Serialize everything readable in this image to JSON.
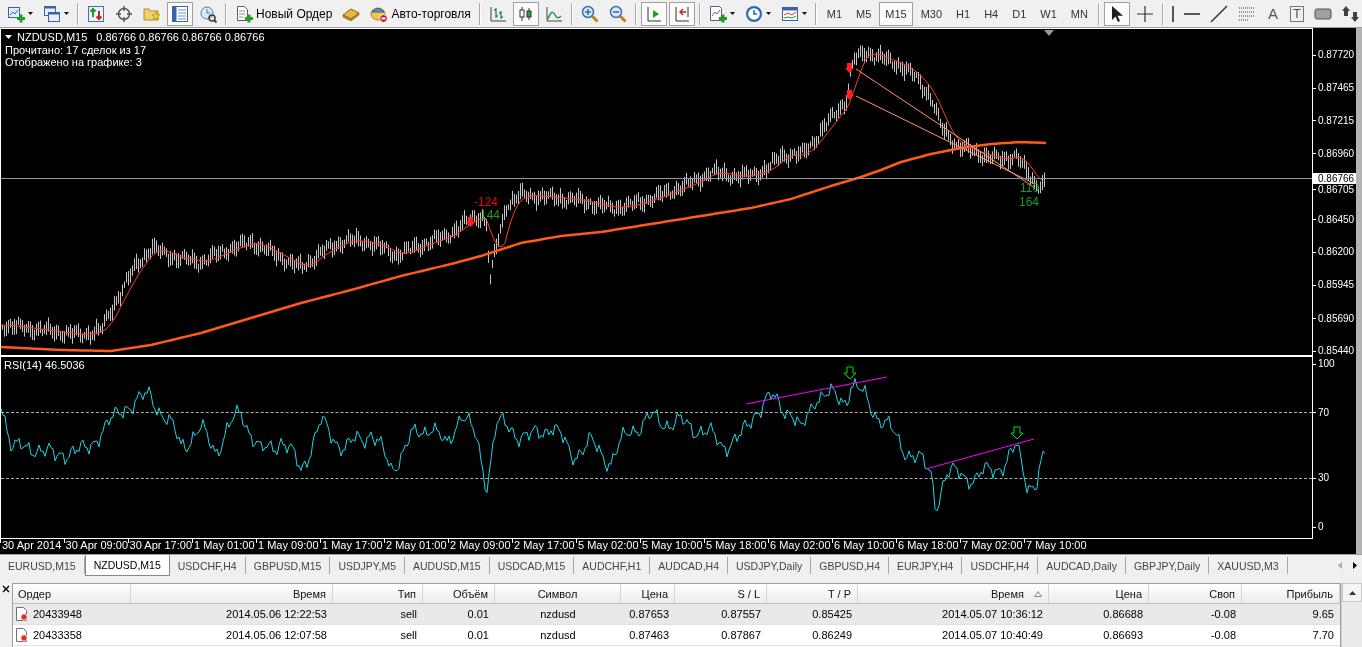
{
  "toolbar": [
    {
      "items": [
        {
          "kind": "icon",
          "dropdown": true,
          "pressed": false
        },
        {
          "kind": "icon",
          "dropdown": true,
          "pressed": false
        }
      ]
    },
    {
      "items": [
        {
          "kind": "icon",
          "pressed": false
        },
        {
          "kind": "icon",
          "pressed": false
        },
        {
          "kind": "icon",
          "pressed": false
        },
        {
          "kind": "icon",
          "pressed": true
        },
        {
          "kind": "icon",
          "pressed": false
        }
      ]
    },
    {
      "items": [
        {
          "kind": "icon_label",
          "label": "Новый Ордер",
          "pressed": false
        },
        {
          "kind": "icon",
          "pressed": false
        },
        {
          "kind": "icon_label",
          "label": "Авто-торговля",
          "pressed": false
        }
      ]
    },
    {
      "items": [
        {
          "kind": "icon",
          "pressed": false
        },
        {
          "kind": "icon",
          "pressed": true
        },
        {
          "kind": "icon",
          "pressed": false
        }
      ]
    },
    {
      "items": [
        {
          "kind": "icon",
          "pressed": false
        },
        {
          "kind": "icon",
          "pressed": false
        }
      ]
    },
    {
      "items": [
        {
          "kind": "icon",
          "pressed": true
        },
        {
          "kind": "icon",
          "pressed": true
        }
      ]
    },
    {
      "items": [
        {
          "kind": "icon",
          "dropdown": true,
          "pressed": false
        },
        {
          "kind": "icon",
          "dropdown": true,
          "pressed": false
        },
        {
          "kind": "icon",
          "dropdown": true,
          "pressed": false
        }
      ]
    },
    {
      "items": [
        {
          "kind": "text",
          "label": "M1",
          "selected": false
        },
        {
          "kind": "text",
          "label": "M5",
          "selected": false
        },
        {
          "kind": "text",
          "label": "M15",
          "selected": true
        },
        {
          "kind": "text",
          "label": "M30",
          "selected": false
        },
        {
          "kind": "text",
          "label": "H1",
          "selected": false
        },
        {
          "kind": "text",
          "label": "H4",
          "selected": false
        },
        {
          "kind": "text",
          "label": "D1",
          "selected": false
        },
        {
          "kind": "text",
          "label": "W1",
          "selected": false
        },
        {
          "kind": "text",
          "label": "MN",
          "selected": false
        }
      ]
    },
    {
      "items": [
        {
          "kind": "icon",
          "pressed": true
        },
        {
          "kind": "icon",
          "pressed": false
        }
      ]
    },
    {
      "items": [
        {
          "kind": "icon",
          "pressed": false
        },
        {
          "kind": "icon",
          "pressed": false
        },
        {
          "kind": "icon",
          "pressed": false
        },
        {
          "kind": "icon",
          "pressed": false
        },
        {
          "kind": "glyph",
          "label": "A",
          "pressed": false
        },
        {
          "kind": "boxed_glyph",
          "label": "T",
          "pressed": false
        },
        {
          "kind": "icon",
          "pressed": false
        },
        {
          "kind": "icon",
          "pressed": false
        }
      ]
    }
  ],
  "chart": {
    "symbol": "NZDUSD,M15",
    "ohlc": "0.86766 0.86766 0.86766 0.86766",
    "info_lines": [
      "Прочитано: 17 сделок из 17",
      "Отображено на графике: 3"
    ],
    "price_axis": [
      "0.87720",
      "0.87465",
      "0.87215",
      "0.86960",
      "0.86705",
      "0.86450",
      "0.86200",
      "0.85945",
      "0.85690",
      "0.85440"
    ],
    "current_price": "0.86766",
    "trade_labels": [
      {
        "text": "-124",
        "color": "#ff0000"
      },
      {
        "text": "144",
        "color": "#1e9a1e"
      },
      {
        "text": "110",
        "color": "#1e9a1e"
      },
      {
        "text": "164",
        "color": "#1e9a1e"
      }
    ],
    "indicator": {
      "label": "RSI(14) 46.5036",
      "axis": [
        {
          "label": "100",
          "level_line": false
        },
        {
          "label": "70",
          "level_line": true
        },
        {
          "label": "30",
          "level_line": true
        },
        {
          "label": "0",
          "level_line": false
        }
      ]
    },
    "time_axis": [
      "30 Apr 2014",
      "30 Apr 09:00",
      "30 Apr 17:00",
      "1 May 01:00",
      "1 May 09:00",
      "1 May 17:00",
      "2 May 01:00",
      "2 May 09:00",
      "2 May 17:00",
      "5 May 02:00",
      "5 May 10:00",
      "5 May 18:00",
      "6 May 02:00",
      "6 May 10:00",
      "6 May 18:00",
      "7 May 02:00",
      "7 May 10:00"
    ]
  },
  "tabs": [
    {
      "label": "EURUSD,M15",
      "selected": false
    },
    {
      "label": "NZDUSD,M15",
      "selected": true
    },
    {
      "label": "USDCHF,H4",
      "selected": false
    },
    {
      "label": "GBPUSD,M15",
      "selected": false
    },
    {
      "label": "USDJPY,M5",
      "selected": false
    },
    {
      "label": "AUDUSD,M15",
      "selected": false
    },
    {
      "label": "USDCAD,M15",
      "selected": false
    },
    {
      "label": "AUDCHF,H1",
      "selected": false
    },
    {
      "label": "AUDCAD,H4",
      "selected": false
    },
    {
      "label": "USDJPY,Daily",
      "selected": false
    },
    {
      "label": "GBPUSD,H4",
      "selected": false
    },
    {
      "label": "EURJPY,H4",
      "selected": false
    },
    {
      "label": "USDCHF,H4",
      "selected": false
    },
    {
      "label": "AUDCAD,Daily",
      "selected": false
    },
    {
      "label": "GBPJPY,Daily",
      "selected": false
    },
    {
      "label": "XAUUSD,M3",
      "selected": false
    }
  ],
  "terminal": {
    "columns": [
      {
        "label": "Ордер",
        "sorted": false
      },
      {
        "label": "Время",
        "sorted": false
      },
      {
        "label": "Тип",
        "sorted": false
      },
      {
        "label": "Объём",
        "sorted": false
      },
      {
        "label": "Символ",
        "sorted": false
      },
      {
        "label": "Цена",
        "sorted": false
      },
      {
        "label": "S / L",
        "sorted": false
      },
      {
        "label": "T / P",
        "sorted": false
      },
      {
        "label": "Время",
        "sorted": true
      },
      {
        "label": "Цена",
        "sorted": false
      },
      {
        "label": "Своп",
        "sorted": false
      },
      {
        "label": "Прибыль",
        "sorted": false
      }
    ],
    "rows": [
      {
        "selected": true,
        "cells": [
          "20433948",
          "2014.05.06 12:22:53",
          "sell",
          "0.01",
          "nzdusd",
          "0.87653",
          "0.87557",
          "0.85425",
          "2014.05.07 10:36:12",
          "0.86688",
          "-0.08",
          "9.65"
        ]
      },
      {
        "selected": false,
        "cells": [
          "20433358",
          "2014.05.06 12:07:58",
          "sell",
          "0.01",
          "nzdusd",
          "0.87463",
          "0.87867",
          "0.86249",
          "2014.05.07 10:40:49",
          "0.86693",
          "-0.08",
          "7.70"
        ]
      }
    ]
  }
}
